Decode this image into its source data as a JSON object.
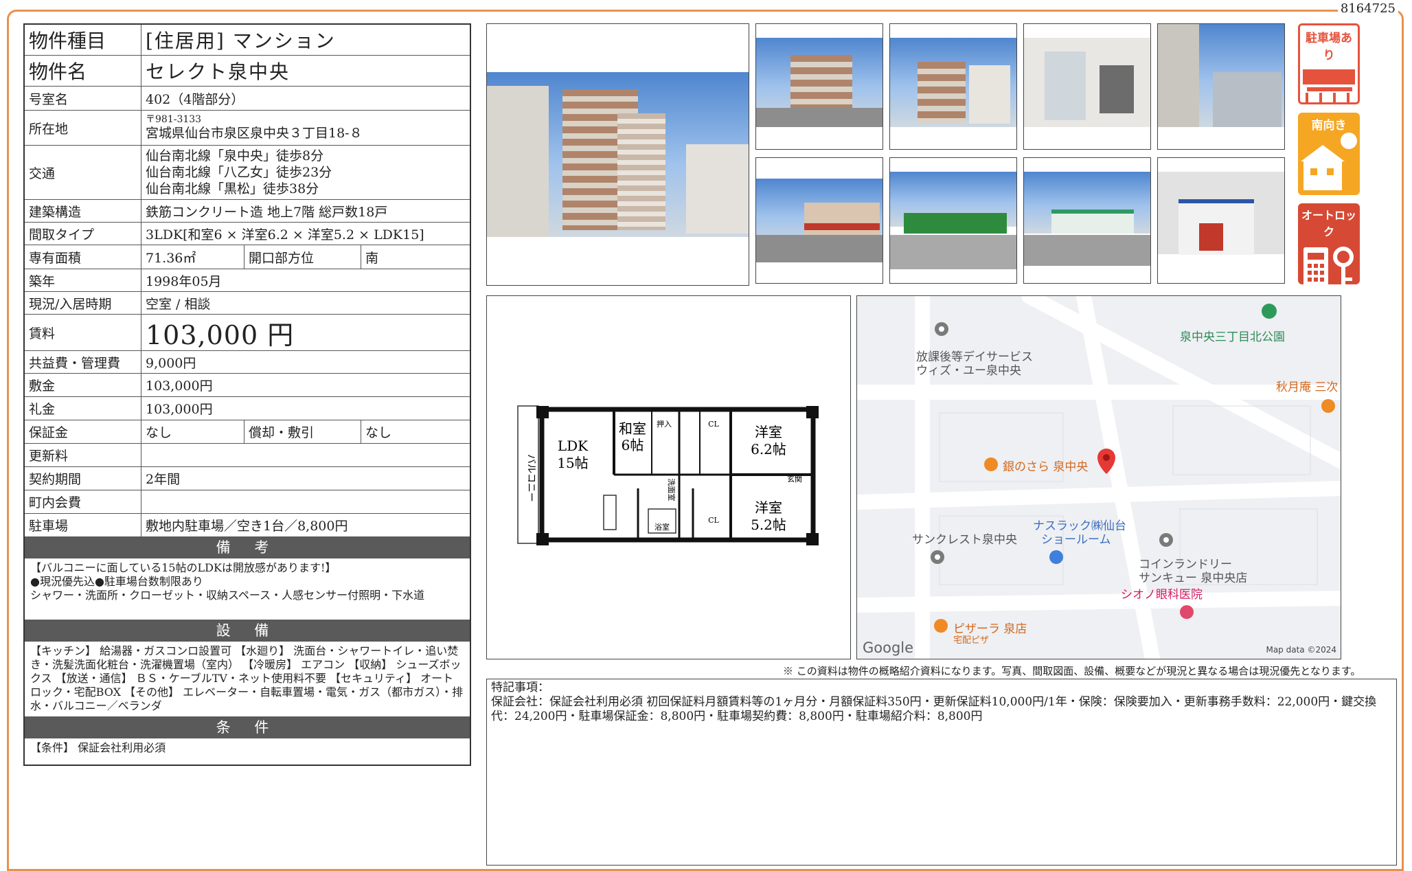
{
  "doc_number": "8164725",
  "spec": {
    "type_label": "物件種目",
    "type_value": "[住居用] マンション",
    "name_label": "物件名",
    "name_value": "セレクト泉中央",
    "room_label": "号室名",
    "room_value": "402（4階部分）",
    "address_label": "所在地",
    "postal": "〒981-3133",
    "address": "宮城県仙台市泉区泉中央３丁目18-８",
    "traffic_label": "交通",
    "traffic": [
      "仙台南北線「泉中央」徒歩8分",
      "仙台南北線「八乙女」徒歩23分",
      "仙台南北線「黒松」徒歩38分"
    ],
    "structure_label": "建築構造",
    "structure_value": "鉄筋コンクリート造 地上7階 総戸数18戸",
    "layout_label": "間取タイプ",
    "layout_value": "3LDK[和室6 × 洋室6.2 × 洋室5.2 × LDK15]",
    "area_label": "専有面積",
    "area_value": "71.36㎡",
    "direction_label": "開口部方位",
    "direction_value": "南",
    "built_label": "築年",
    "built_value": "1998年05月",
    "status_label": "現況/入居時期",
    "status_value": "空室 / 相談",
    "rent_label": "賃料",
    "rent_value": "103,000 円",
    "fee_label": "共益費・管理費",
    "fee_value": "9,000円",
    "deposit_label": "敷金",
    "deposit_value": "103,000円",
    "keymoney_label": "礼金",
    "keymoney_value": "103,000円",
    "guarantee_label": "保証金",
    "guarantee_value": "なし",
    "amort_label": "償却・敷引",
    "amort_value": "なし",
    "renewal_label": "更新料",
    "renewal_value": "",
    "contract_label": "契約期間",
    "contract_value": "2年間",
    "community_label": "町内会費",
    "community_value": "",
    "parking_label": "駐車場",
    "parking_value": "敷地内駐車場／空き1台／8,800円"
  },
  "remarks": {
    "title": "備 考",
    "lines": [
      "【バルコニーに面している15帖のLDKは開放感があります!】",
      "●現況優先込●駐車場台数制限あり",
      "シャワー・洗面所・クローゼット・収納スペース・人感センサー付照明・下水道"
    ]
  },
  "equipment": {
    "title": "設 備",
    "text": "【キッチン】 給湯器・ガスコンロ設置可 【水廻り】 洗面台・シャワートイレ・追い焚き・洗髪洗面化粧台・洗濯機置場（室内） 【冷暖房】 エアコン 【収納】 シューズボックス 【放送・通信】 ＢＳ・ケーブルTV・ネット使用料不要 【セキュリティ】 オートロック・宅配BOX 【その他】 エレベーター・自転車置場・電気・ガス（都市ガス）・排水・バルコニー／ベランダ"
  },
  "conditions": {
    "title": "条 件",
    "text": "【条件】 保証会社利用必須"
  },
  "badges": [
    "駐車場あり",
    "南向き",
    "オートロック"
  ],
  "floorplan": {
    "ldk": "LDK",
    "ldk_size": "15帖",
    "washitsu": "和室",
    "washitsu_size": "6帖",
    "yoshitsu1": "洋室",
    "yoshitsu1_size": "6.2帖",
    "yoshitsu2": "洋室",
    "yoshitsu2_size": "5.2帖",
    "balcony": "バルコニー",
    "entrance": "玄関",
    "bath": "浴室",
    "wash": "洗面室",
    "closet": "CL",
    "oshiire": "押入"
  },
  "map": {
    "labels": [
      "放課後等デイサービス",
      "ウィズ・ユー泉中央",
      "泉中央三丁目北公園",
      "秋月庵 三次",
      "銀のさら 泉中央",
      "ナスラック㈱仙台",
      "ショールーム",
      "サンクレスト泉中央",
      "コインランドリー",
      "サンキュー 泉中央店",
      "シオノ眼科医院",
      "ピザーラ 泉店",
      "宅配ピザ"
    ],
    "google": "Google",
    "credit": "Map data ©2024"
  },
  "disclaimer": "※ この資料は物件の概略紹介資料になります。写真、間取図面、設備、概要などが現況と異なる場合は現況優先となります。",
  "special": {
    "title": "特記事項：",
    "text": "保証会社：保証会社利用必須 初回保証料月額賃料等の1ヶ月分・月額保証料350円・更新保証料10,000円/1年・保険：保険要加入・更新事務手数料：22,000円・鍵交換代：24,200円・駐車場保証金：8,800円・駐車場契約費：8,800円・駐車場紹介料：8,800円"
  }
}
